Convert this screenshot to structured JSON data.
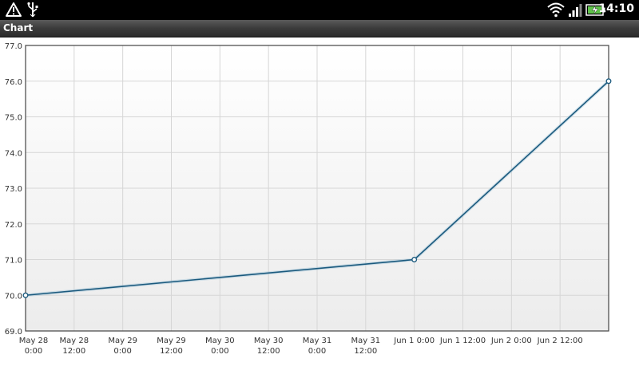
{
  "status_bar": {
    "time": "14:10",
    "left_icons": [
      "warning-icon",
      "usb-icon"
    ],
    "right_icons": [
      "wifi-icon",
      "signal-icon",
      "battery-charging-icon"
    ]
  },
  "title_bar": {
    "title": "Chart"
  },
  "chart_data": {
    "type": "line",
    "title": "",
    "xlabel": "",
    "ylabel": "",
    "x": [
      "2011-05-28 0:00",
      "2011-06-01 0:00",
      "2011-06-03 0:00"
    ],
    "series": [
      {
        "values": [
          70.0,
          71.0,
          76.0
        ],
        "color": "#1b5a7e"
      }
    ],
    "ylim": [
      69.0,
      77.0
    ],
    "y_ticks": [
      "69.0",
      "70.0",
      "71.0",
      "72.0",
      "73.0",
      "74.0",
      "75.0",
      "76.0",
      "77.0"
    ],
    "x_tick_labels": [
      [
        "May 28",
        "0:00"
      ],
      [
        "May 28",
        "12:00"
      ],
      [
        "May 29",
        "0:00"
      ],
      [
        "May 29",
        "12:00"
      ],
      [
        "May 30",
        "0:00"
      ],
      [
        "May 30",
        "12:00"
      ],
      [
        "May 31",
        "0:00"
      ],
      [
        "May 31",
        "12:00"
      ],
      [
        "Jun 1 0:00"
      ],
      [
        "Jun 1 12:00"
      ],
      [
        "Jun 2 0:00"
      ],
      [
        "Jun 2 12:00"
      ]
    ],
    "grid": true,
    "colors": {
      "line": "#1b5a7e",
      "grid": "#d6d6d6",
      "axis": "#444444",
      "label": "#333333"
    }
  }
}
